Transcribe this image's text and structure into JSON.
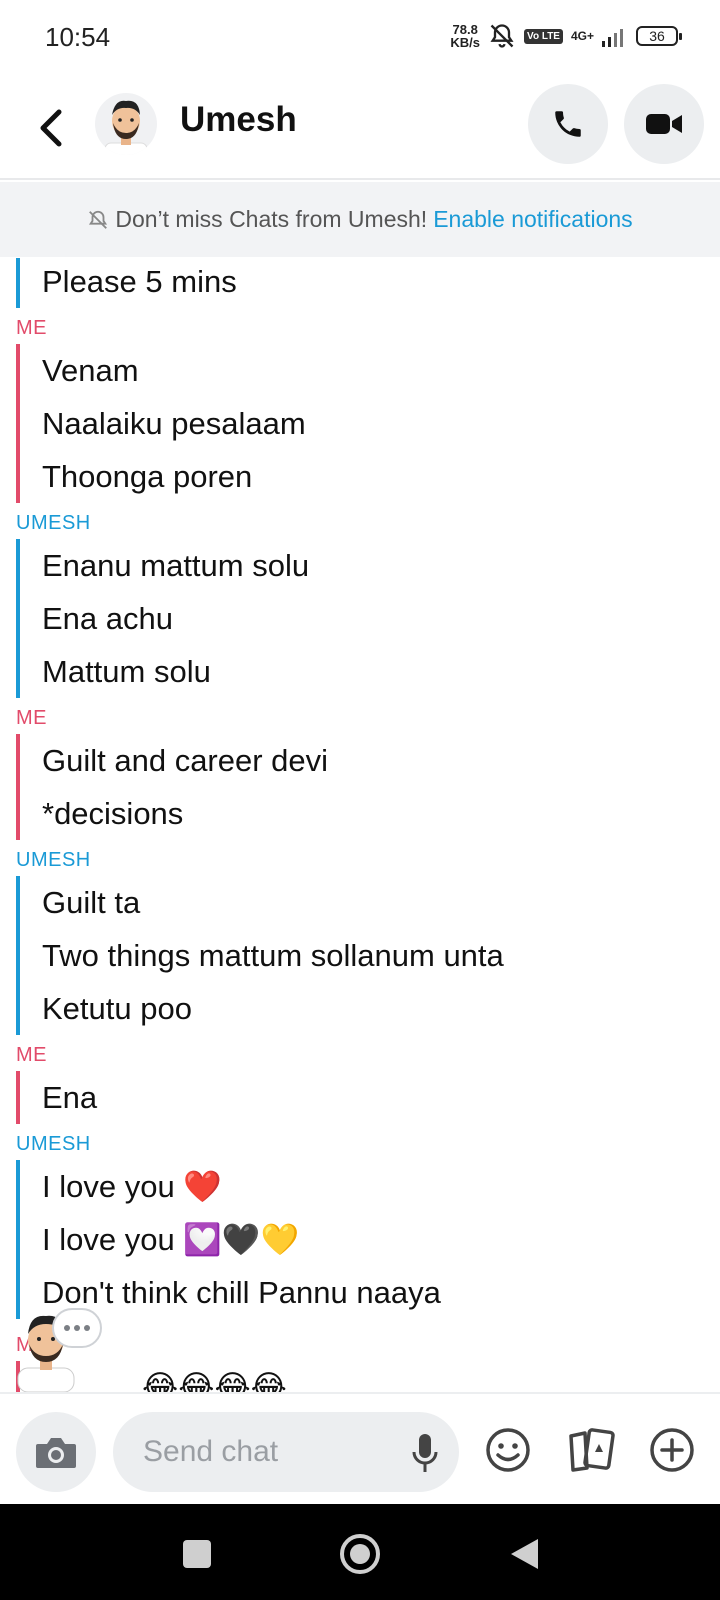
{
  "status_bar": {
    "time": "10:54",
    "net_speed_value": "78.8",
    "net_speed_unit": "KB/s",
    "volte": "Vo LTE",
    "network": "4G+",
    "battery": "36"
  },
  "header": {
    "contact_name": "Umesh"
  },
  "notification_banner": {
    "text": "Don’t miss Chats from Umesh!",
    "link": "Enable notifications"
  },
  "messages": {
    "g0": [
      "Please 5 mins"
    ],
    "s1": "ME",
    "g1": [
      "Venam",
      "Naalaiku pesalaam",
      "Thoonga poren"
    ],
    "s2": "UMESH",
    "g2": [
      "Enanu mattum solu",
      "Ena achu",
      "Mattum solu"
    ],
    "s3": "ME",
    "g3": [
      "Guilt and career devi",
      "*decisions"
    ],
    "s4": "UMESH",
    "g4": [
      "Guilt ta",
      "Two things mattum sollanum unta",
      "Ketutu poo"
    ],
    "s5": "ME",
    "g5": [
      "Ena"
    ],
    "s6": "UMESH",
    "g6_text": [
      "I love you",
      "I love you",
      "Don't think chill Pannu naaya"
    ],
    "g6_emoji": [
      "❤️",
      "💟🖤💛"
    ],
    "s7": "ME",
    "g7": [
      "😂😂😂😂"
    ]
  },
  "composer": {
    "placeholder": "Send chat"
  },
  "colors": {
    "me": "#e24b6a",
    "them": "#1a9ad6",
    "link": "#1a9ad6"
  }
}
